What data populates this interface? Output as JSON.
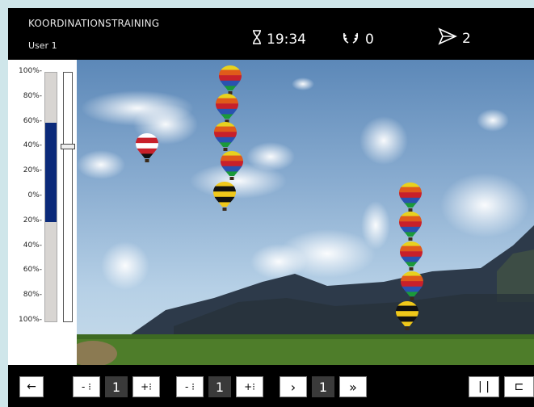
{
  "header": {
    "title": "KOORDINATIONSTRAINING",
    "user": "User 1",
    "timer_icon": "hourglass-icon",
    "timer": "19:34",
    "score_icon": "laurel-icon",
    "score": "0",
    "plane_icon": "paper-plane-icon",
    "plane_count": "2"
  },
  "meter": {
    "labels": [
      "100%-",
      "80%-",
      "60%-",
      "40%-",
      "20%-",
      "0%-",
      "20%-",
      "40%-",
      "60%-",
      "80%-",
      "100%-"
    ],
    "level_top_fraction": 0.6,
    "level_bottom_fraction": -0.2,
    "slider_fraction": 0.4,
    "fill_color": "#0b2a7a"
  },
  "controls": {
    "back_label": "←",
    "group1": {
      "minus": "- ⁝",
      "value": "1",
      "plus": "+⁝"
    },
    "group2": {
      "minus": "- ⁝",
      "value": "1",
      "plus": "+⁝"
    },
    "group3": {
      "next": "›",
      "value": "1",
      "fast": "»"
    },
    "pause_label": "| |",
    "exit_label": "⊏"
  }
}
